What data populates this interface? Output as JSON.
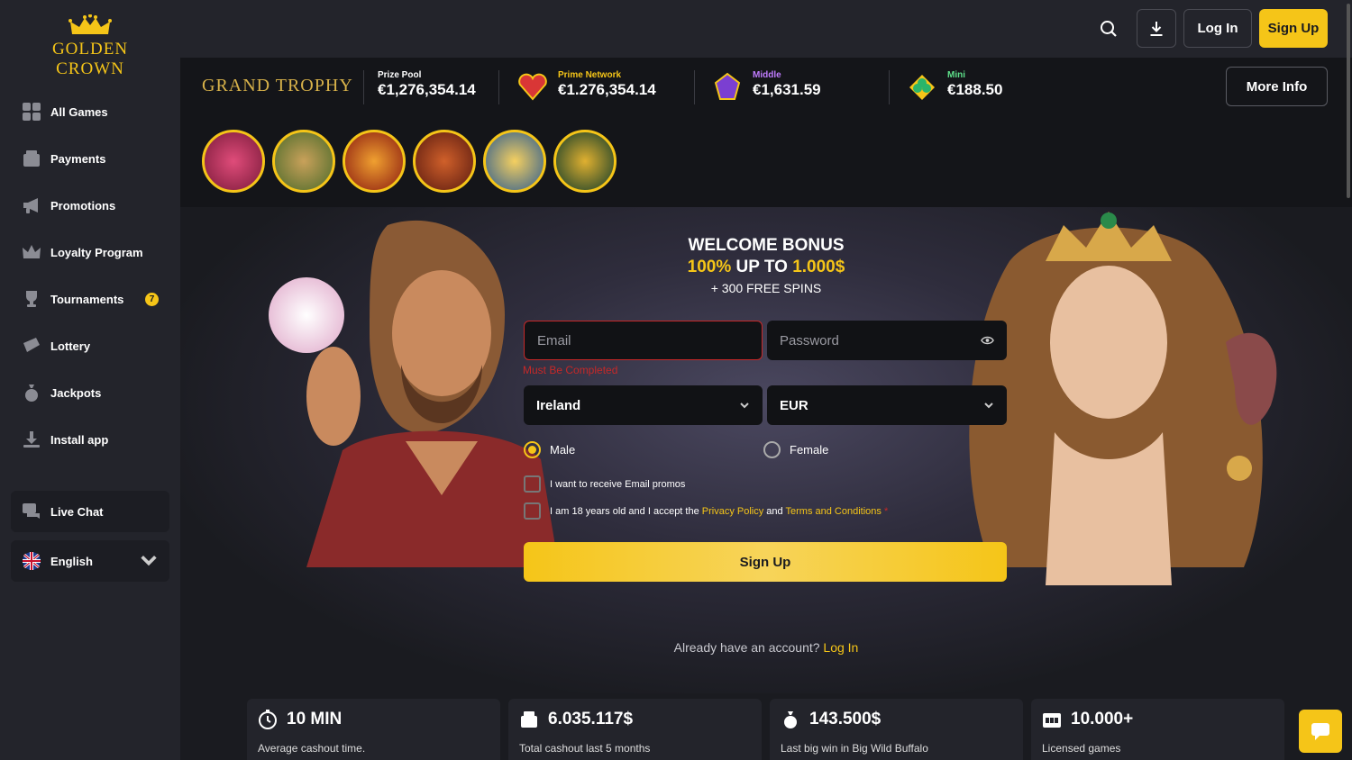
{
  "brand": {
    "name": "GOLDEN CROWN",
    "accent": "#f5c518"
  },
  "sidebar": {
    "items": [
      {
        "label": "All Games",
        "icon": "grid-icon"
      },
      {
        "label": "Payments",
        "icon": "wallet-icon"
      },
      {
        "label": "Promotions",
        "icon": "megaphone-icon"
      },
      {
        "label": "Loyalty Program",
        "icon": "crown-icon"
      },
      {
        "label": "Tournaments",
        "icon": "trophy-icon",
        "badge": "7"
      },
      {
        "label": "Lottery",
        "icon": "ticket-icon"
      },
      {
        "label": "Jackpots",
        "icon": "money-bag-icon"
      },
      {
        "label": "Install app",
        "icon": "download-icon"
      }
    ],
    "live_chat": "Live Chat",
    "language": "English"
  },
  "header": {
    "login": "Log In",
    "signup": "Sign Up"
  },
  "jackpot": {
    "title": "GRAND TROPHY",
    "prize_pool_label": "Prize Pool",
    "prize_pool_value": "€1,276,354.14",
    "tiers": [
      {
        "label": "Prime Network",
        "value": "€1.276,354.14",
        "color": "#f5c518"
      },
      {
        "label": "Middle",
        "value": "€1,631.59",
        "color": "#c07cff"
      },
      {
        "label": "Mini",
        "value": "€188.50",
        "color": "#5ee08a"
      }
    ],
    "more_info": "More Info"
  },
  "games": [
    {
      "name": "game-thumb-dice",
      "color": "#b0305a"
    },
    {
      "name": "game-thumb-lady",
      "color": "#6b8a3a"
    },
    {
      "name": "game-thumb-coins",
      "color": "#c23a1a"
    },
    {
      "name": "game-thumb-big-wild-buffalo",
      "color": "#9a2a1a"
    },
    {
      "name": "game-thumb-crown",
      "color": "#3a6aa0"
    },
    {
      "name": "game-thumb-gold-coins",
      "color": "#1a5a3a"
    }
  ],
  "welcome": {
    "title": "WELCOME BONUS",
    "line2_pct": "100%",
    "line2_mid": " UP TO ",
    "line2_amount": "1.000$",
    "line3": "+ 300 FREE SPINS"
  },
  "form": {
    "email_placeholder": "Email",
    "password_placeholder": "Password",
    "email_error": "Must Be Completed",
    "country": "Ireland",
    "currency": "EUR",
    "gender_male": "Male",
    "gender_female": "Female",
    "promo_checkbox": "I want to receive Email promos",
    "terms_prefix": "I am 18 years old and I accept the ",
    "privacy_link": "Privacy Policy",
    "terms_and": " and ",
    "terms_link": "Terms and Conditions",
    "terms_req": " *",
    "submit": "Sign Up",
    "already_text": "Already have an account? ",
    "already_link": "Log In"
  },
  "stats": [
    {
      "value": "10 MIN",
      "label": "Average cashout time.",
      "icon": "stopwatch-icon"
    },
    {
      "value": "6.035.117$",
      "label": "Total cashout last 5 months",
      "icon": "wallet-icon"
    },
    {
      "value": "143.500$",
      "label": "Last big win in Big Wild Buffalo",
      "icon": "money-bag-icon"
    },
    {
      "value": "10.000+",
      "label": "Licensed games",
      "icon": "slot-machine-icon"
    }
  ]
}
